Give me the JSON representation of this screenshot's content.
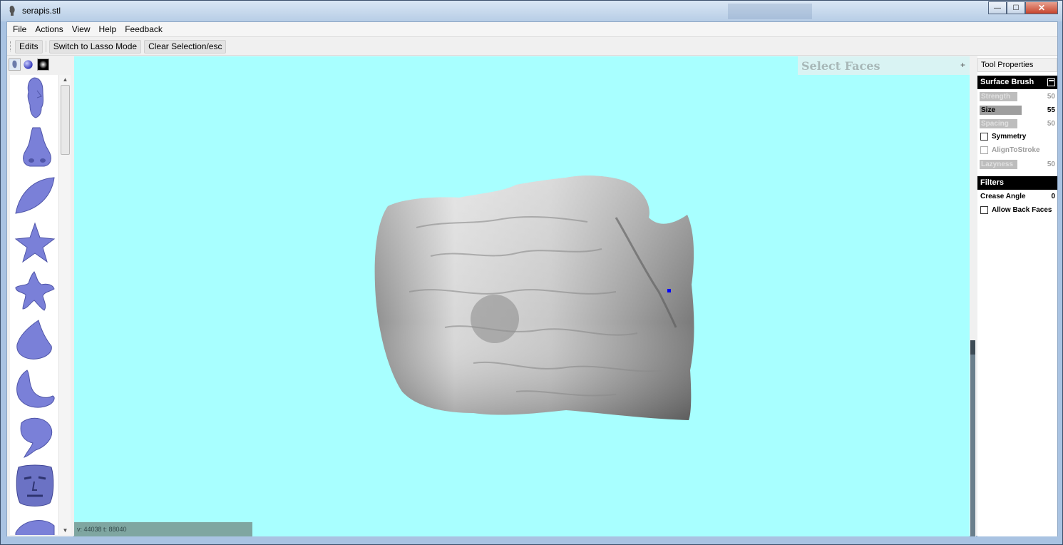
{
  "window": {
    "title": "serapis.stl",
    "controls": {
      "minimize": "—",
      "maximize": "☐",
      "close": "✕"
    }
  },
  "menu": [
    "File",
    "Actions",
    "View",
    "Help",
    "Feedback"
  ],
  "toolbar": {
    "edits_label": "Edits",
    "lasso_label": "Switch to Lasso Mode",
    "clear_label": "Clear Selection/esc"
  },
  "palette": {
    "tabs": [
      "head-icon",
      "sphere-icon",
      "texture-icon"
    ],
    "items": [
      "face-shape-icon",
      "nose-shape-icon",
      "leaf-shape-icon",
      "star-shape-icon",
      "starfish-shape-icon",
      "wedge-shape-icon",
      "crescent-shape-icon",
      "comma-shape-icon",
      "mask-shape-icon",
      "dome-shape-icon"
    ]
  },
  "viewport": {
    "panel_title": "Select Faces",
    "panel_plus": "+",
    "status": "v: 44038 t: 88040",
    "background": "#a8ffff"
  },
  "tool_properties": {
    "header": "Tool Properties",
    "surface_brush": {
      "title": "Surface Brush",
      "strength": {
        "label": "Strength",
        "value": "50"
      },
      "size": {
        "label": "Size",
        "value": "55"
      },
      "spacing": {
        "label": "Spacing",
        "value": "50"
      },
      "symmetry": {
        "label": "Symmetry",
        "checked": false
      },
      "align_to_stroke": {
        "label": "AlignToStroke",
        "checked": false
      },
      "lazyness": {
        "label": "Lazyness",
        "value": "50"
      }
    },
    "filters": {
      "title": "Filters",
      "crease_angle": {
        "label": "Crease Angle",
        "value": "0"
      },
      "allow_back_faces": {
        "label": "Allow Back Faces",
        "checked": false
      }
    }
  }
}
